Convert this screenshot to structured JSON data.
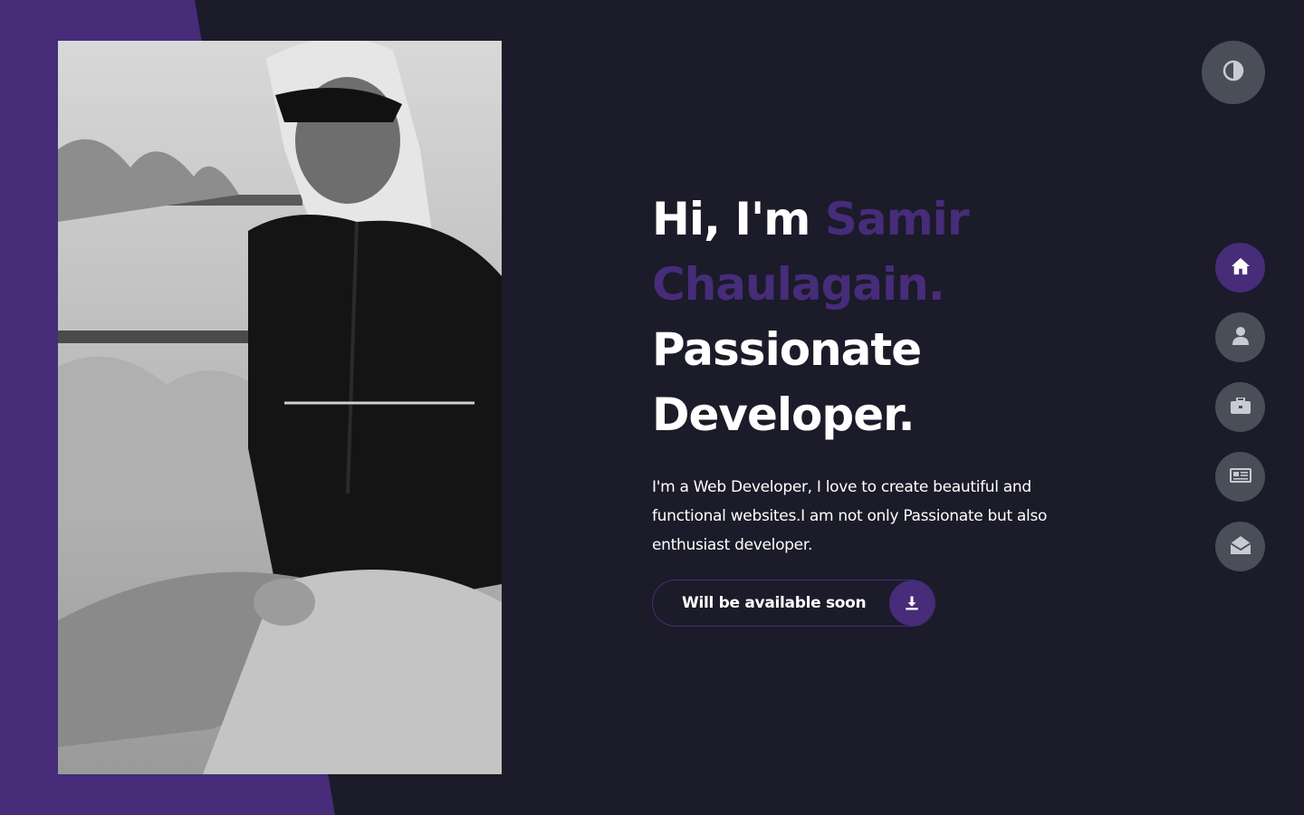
{
  "colors": {
    "background": "#1b1b29",
    "accent": "#462c79",
    "nav_button": "#4a4e59",
    "text": "#ffffff",
    "icon": "#c9cbd3"
  },
  "portrait": {
    "alt": "Portrait photo"
  },
  "hero": {
    "greeting": "Hi, I'm",
    "name_first": "Samir",
    "name_last": "Chaulagain.",
    "title_1": "Passionate",
    "title_2": "Developer.",
    "intro": "I'm a Web Developer, I love to create beautiful and functional websites.I am not only Passionate but also enthusiast developer."
  },
  "cta": {
    "label": "Will be available soon",
    "icon": "download-icon"
  },
  "theme_toggle": {
    "icon": "contrast-icon"
  },
  "nav": {
    "items": [
      {
        "key": "home",
        "icon": "home-icon",
        "active": true
      },
      {
        "key": "about",
        "icon": "user-icon",
        "active": false
      },
      {
        "key": "portfolio",
        "icon": "briefcase-icon",
        "active": false
      },
      {
        "key": "blog",
        "icon": "newspaper-icon",
        "active": false
      },
      {
        "key": "contact",
        "icon": "envelope-open-icon",
        "active": false
      }
    ]
  }
}
